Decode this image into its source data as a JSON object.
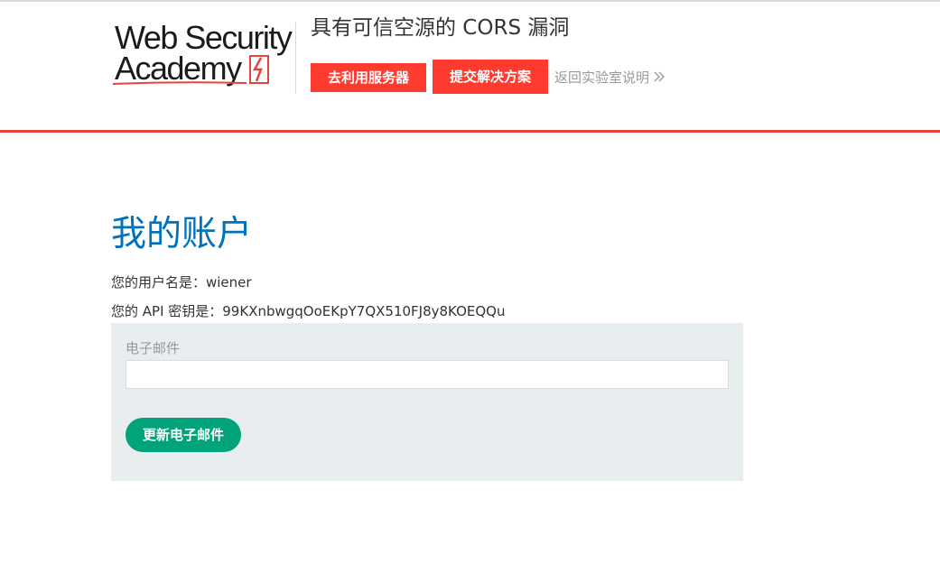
{
  "header": {
    "logo_line1": "Web Security",
    "logo_line2": "Academy",
    "lab_title": "具有可信空源的 CORS 漏洞",
    "exploit_button": "去利用服务器",
    "submit_button": "提交解决方案",
    "back_link": "返回实验室说明",
    "accent_color": "#e8423f"
  },
  "main": {
    "heading": "我的账户",
    "username_line": "您的用户名是：wiener",
    "apikey_line": "您的 API 密钥是：99KXnbwgqOoEKpY7QX510FJ8y8KOEQQu",
    "form": {
      "email_label": "电子邮件",
      "email_value": "",
      "update_button": "更新电子邮件"
    }
  },
  "icons": {
    "logo_mark": "lightning-bolt-icon",
    "back_chevron": "double-chevron-right-icon"
  }
}
